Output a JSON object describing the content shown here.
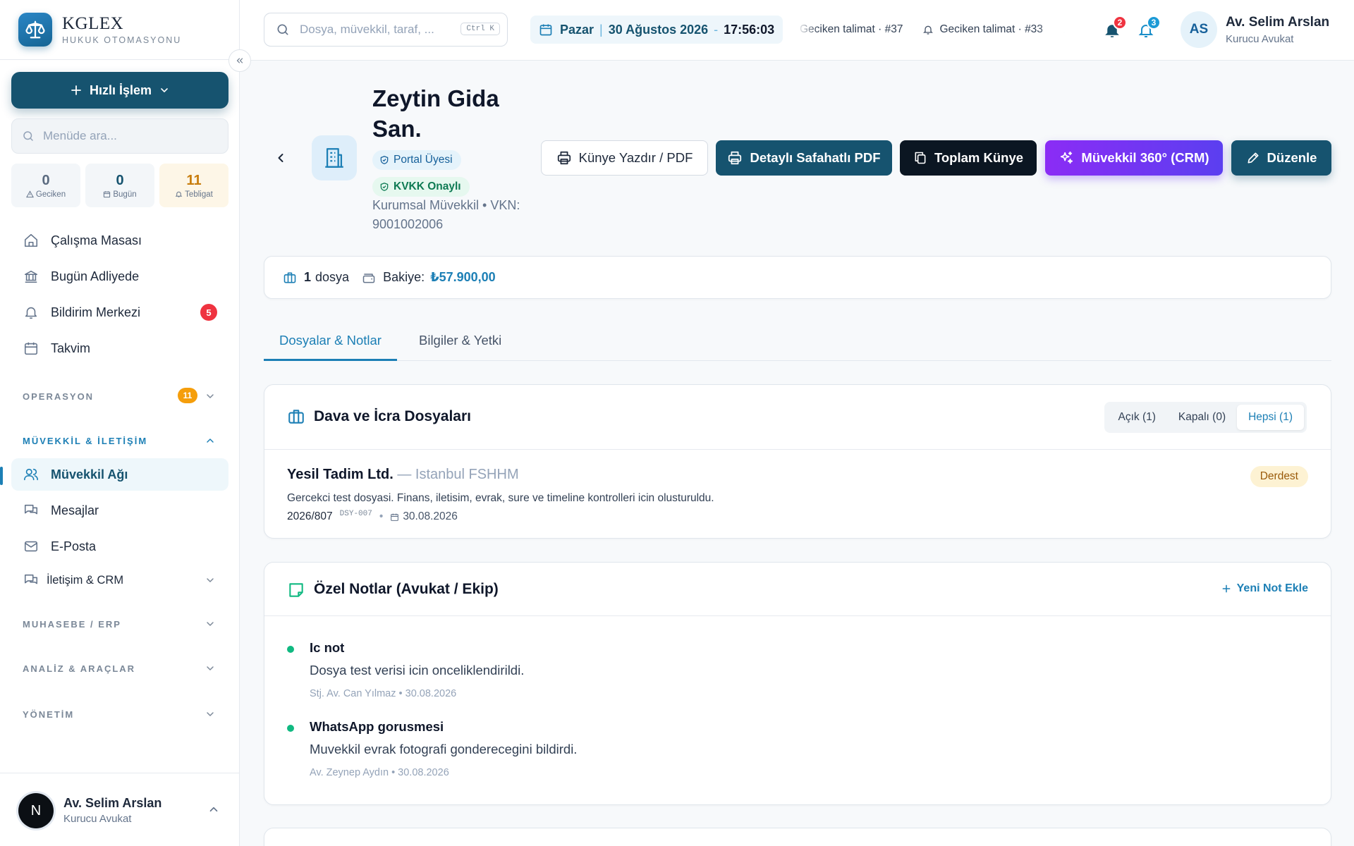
{
  "brand": {
    "name": "KGLEX",
    "subtitle": "HUKUK OTOMASYONU"
  },
  "sidebar": {
    "quick_action": "Hızlı İşlem",
    "search_placeholder": "Menüde ara...",
    "stats": [
      {
        "value": "0",
        "label": "Geciken"
      },
      {
        "value": "0",
        "label": "Bugün"
      },
      {
        "value": "11",
        "label": "Tebligat"
      }
    ],
    "items": [
      {
        "label": "Çalışma Masası",
        "icon": "home-icon"
      },
      {
        "label": "Bugün Adliyede",
        "icon": "courthouse-icon"
      },
      {
        "label": "Bildirim Merkezi",
        "icon": "bell-icon",
        "badge": "5"
      },
      {
        "label": "Takvim",
        "icon": "calendar-icon"
      }
    ],
    "sections": {
      "operasyon": {
        "label": "OPERASYON",
        "badge": "11"
      },
      "muvekkil": {
        "label": "MÜVEKKİL & İLETİŞİM"
      },
      "muhasebe": {
        "label": "MUHASEBE / ERP"
      },
      "analiz": {
        "label": "ANALİZ & ARAÇLAR"
      },
      "yonetim": {
        "label": "YÖNETİM"
      }
    },
    "sub_items": [
      {
        "label": "Müvekkil Ağı",
        "icon": "users-icon",
        "active": true
      },
      {
        "label": "Mesajlar",
        "icon": "chat-icon"
      },
      {
        "label": "E-Posta",
        "icon": "mail-icon"
      },
      {
        "label": "İletişim & CRM",
        "icon": "crm-icon"
      }
    ],
    "user": {
      "initial": "N",
      "name": "Av. Selim Arslan",
      "role": "Kurucu Avukat"
    }
  },
  "topbar": {
    "search_placeholder": "Dosya, müvekkil, taraf, ...",
    "shortcut": "Ctrl K",
    "date": {
      "day": "Pazar",
      "date": "30 Ağustos 2026",
      "time": "17:56:03"
    },
    "ticker": [
      "Geciken talimat · #37",
      "Geciken talimat · #33"
    ],
    "notif_count_red": "2",
    "notif_count_blue": "3",
    "user": {
      "initials": "AS",
      "name": "Av. Selim Arslan",
      "role": "Kurucu Avukat"
    }
  },
  "client": {
    "name": "Zeytin Gida San.",
    "portal_badge": "Portal Üyesi",
    "kvkk_badge": "KVKK Onaylı",
    "meta": "Kurumsal Müvekkil • VKN: 9001002006"
  },
  "actions": {
    "print": "Künye Yazdır / PDF",
    "detailed_pdf": "Detaylı Safahatlı PDF",
    "toplam": "Toplam Künye",
    "crm": "Müvekkil 360° (CRM)",
    "edit": "Düzenle"
  },
  "summary": {
    "file_count": "1",
    "file_label": "dosya",
    "balance_label": "Bakiye:",
    "balance": "₺57.900,00"
  },
  "tabs": [
    "Dosyalar & Notlar",
    "Bilgiler & Yetki"
  ],
  "cases_card": {
    "title": "Dava ve İcra Dosyaları",
    "filters": [
      "Açık (1)",
      "Kapalı (0)",
      "Hepsi (1)"
    ],
    "cases": [
      {
        "party": "Yesil Tadim Ltd.",
        "court": " — Istanbul FSHHM",
        "description": "Gercekci test dosyasi. Finans, iletisim, evrak, sure ve timeline kontrolleri icin olusturuldu.",
        "number": "2026/807",
        "code": "DSY-007",
        "date": "30.08.2026",
        "status": "Derdest"
      }
    ]
  },
  "notes_card": {
    "title": "Özel Notlar (Avukat / Ekip)",
    "add_label": "Yeni Not Ekle",
    "notes": [
      {
        "title": "Ic not",
        "body": "Dosya test verisi icin onceliklendirildi.",
        "meta": "Stj. Av. Can Yılmaz • 30.08.2026"
      },
      {
        "title": "WhatsApp gorusmesi",
        "body": "Muvekkil evrak fotografi gonderecegini bildirdi.",
        "meta": "Av. Zeynep Aydın • 30.08.2026"
      }
    ]
  },
  "colors": {
    "brand": "#16536f",
    "accent": "#1c7fb5",
    "crm_gradient_start": "#8b2cf5",
    "crm_gradient_end": "#5b3ff0",
    "danger": "#ef3340",
    "warning": "#f59e0b",
    "success": "#10b981"
  }
}
